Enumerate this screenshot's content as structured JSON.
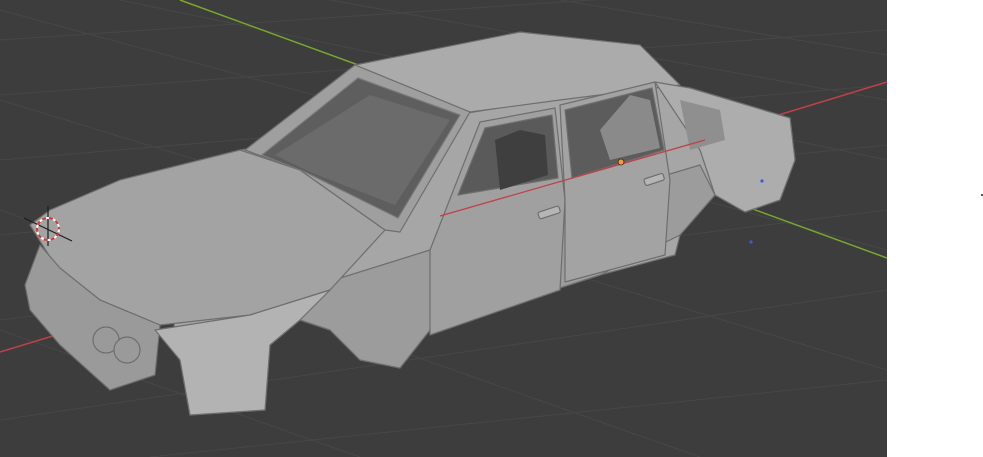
{
  "viewport": {
    "background": "#3d3d3d",
    "grid_color": "#474747",
    "x_axis_color": "#c0404a",
    "y_axis_color": "#7aa82c",
    "selection_color": "#f29a2e",
    "object_color": "#a9a9a9",
    "object_edge_color": "#6e6e6e",
    "cursor_icon": "3d-cursor-icon",
    "origin_icon": "object-origin-icon",
    "light_icon": "light-point-icon"
  },
  "side_panel": {
    "background": "#ffffff"
  }
}
